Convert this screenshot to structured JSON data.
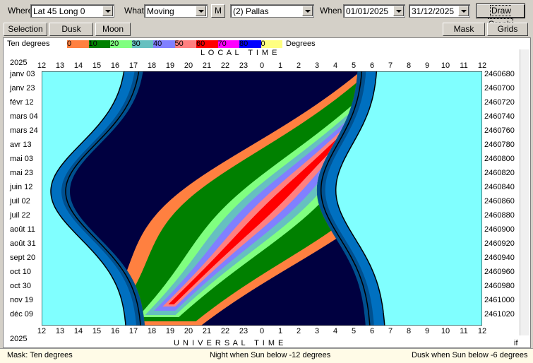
{
  "toolbar": {
    "where_label": "Where",
    "where_value": "Lat 45 Long 0",
    "what_label": "What",
    "what_value": "Moving",
    "m_button": "M",
    "object_value": "(2) Pallas",
    "when_label": "When",
    "date_from": "01/01/2025",
    "date_to": "31/12/2025",
    "draw_graph": "Draw Graph"
  },
  "toolbar2": {
    "selection": "Selection",
    "dusk": "Dusk",
    "moon": "Moon",
    "mask": "Mask",
    "grids": "Grids"
  },
  "legend": {
    "label": "Ten degrees",
    "units": "Degrees",
    "items": [
      {
        "value": "0",
        "color": "#ff8040"
      },
      {
        "value": "10",
        "color": "#008000"
      },
      {
        "value": "20",
        "color": "#80ff80"
      },
      {
        "value": "30",
        "color": "#66c0c0"
      },
      {
        "value": "40",
        "color": "#8080ff"
      },
      {
        "value": "50",
        "color": "#ff8080"
      },
      {
        "value": "60",
        "color": "#ff0000"
      },
      {
        "value": "70",
        "color": "#ff00ff"
      },
      {
        "value": "80",
        "color": "#0000ff"
      },
      {
        "value": "0",
        "color": "#ffff80"
      }
    ]
  },
  "chart": {
    "top_title": "L O C A L   T I M E",
    "bottom_title": "U N I V E R S A L   T I M E",
    "year_top": "2025",
    "year_bottom": "2025",
    "hours": [
      "12",
      "13",
      "14",
      "15",
      "16",
      "17",
      "18",
      "19",
      "20",
      "21",
      "22",
      "23",
      "0",
      "1",
      "2",
      "3",
      "4",
      "5",
      "6",
      "7",
      "8",
      "9",
      "10",
      "11",
      "12"
    ],
    "dates": [
      "janv 03",
      "janv 23",
      "févr 12",
      "mars 04",
      "mars 24",
      "avr 13",
      "mai 03",
      "mai 23",
      "juin 12",
      "juil 02",
      "juil 22",
      "août 11",
      "août 31",
      "sept 20",
      "oct 10",
      "oct 30",
      "nov 19",
      "déc 09"
    ],
    "julian": [
      "2460680",
      "2460700",
      "2460720",
      "2460740",
      "2460760",
      "2460780",
      "2460800",
      "2460820",
      "2460840",
      "2460860",
      "2460880",
      "2460900",
      "2460920",
      "2460940",
      "2460960",
      "2460980",
      "2461000",
      "2461020"
    ],
    "corner_label": "if",
    "colors": {
      "day": "#80ffff",
      "night": "#000040",
      "twilight1": "#004080",
      "twilight2": "#0070c0"
    }
  },
  "status": {
    "left": "Mask:  Ten degrees",
    "center": "Night when Sun below -12 degrees",
    "right": "Dusk when Sun below -6 degrees"
  }
}
